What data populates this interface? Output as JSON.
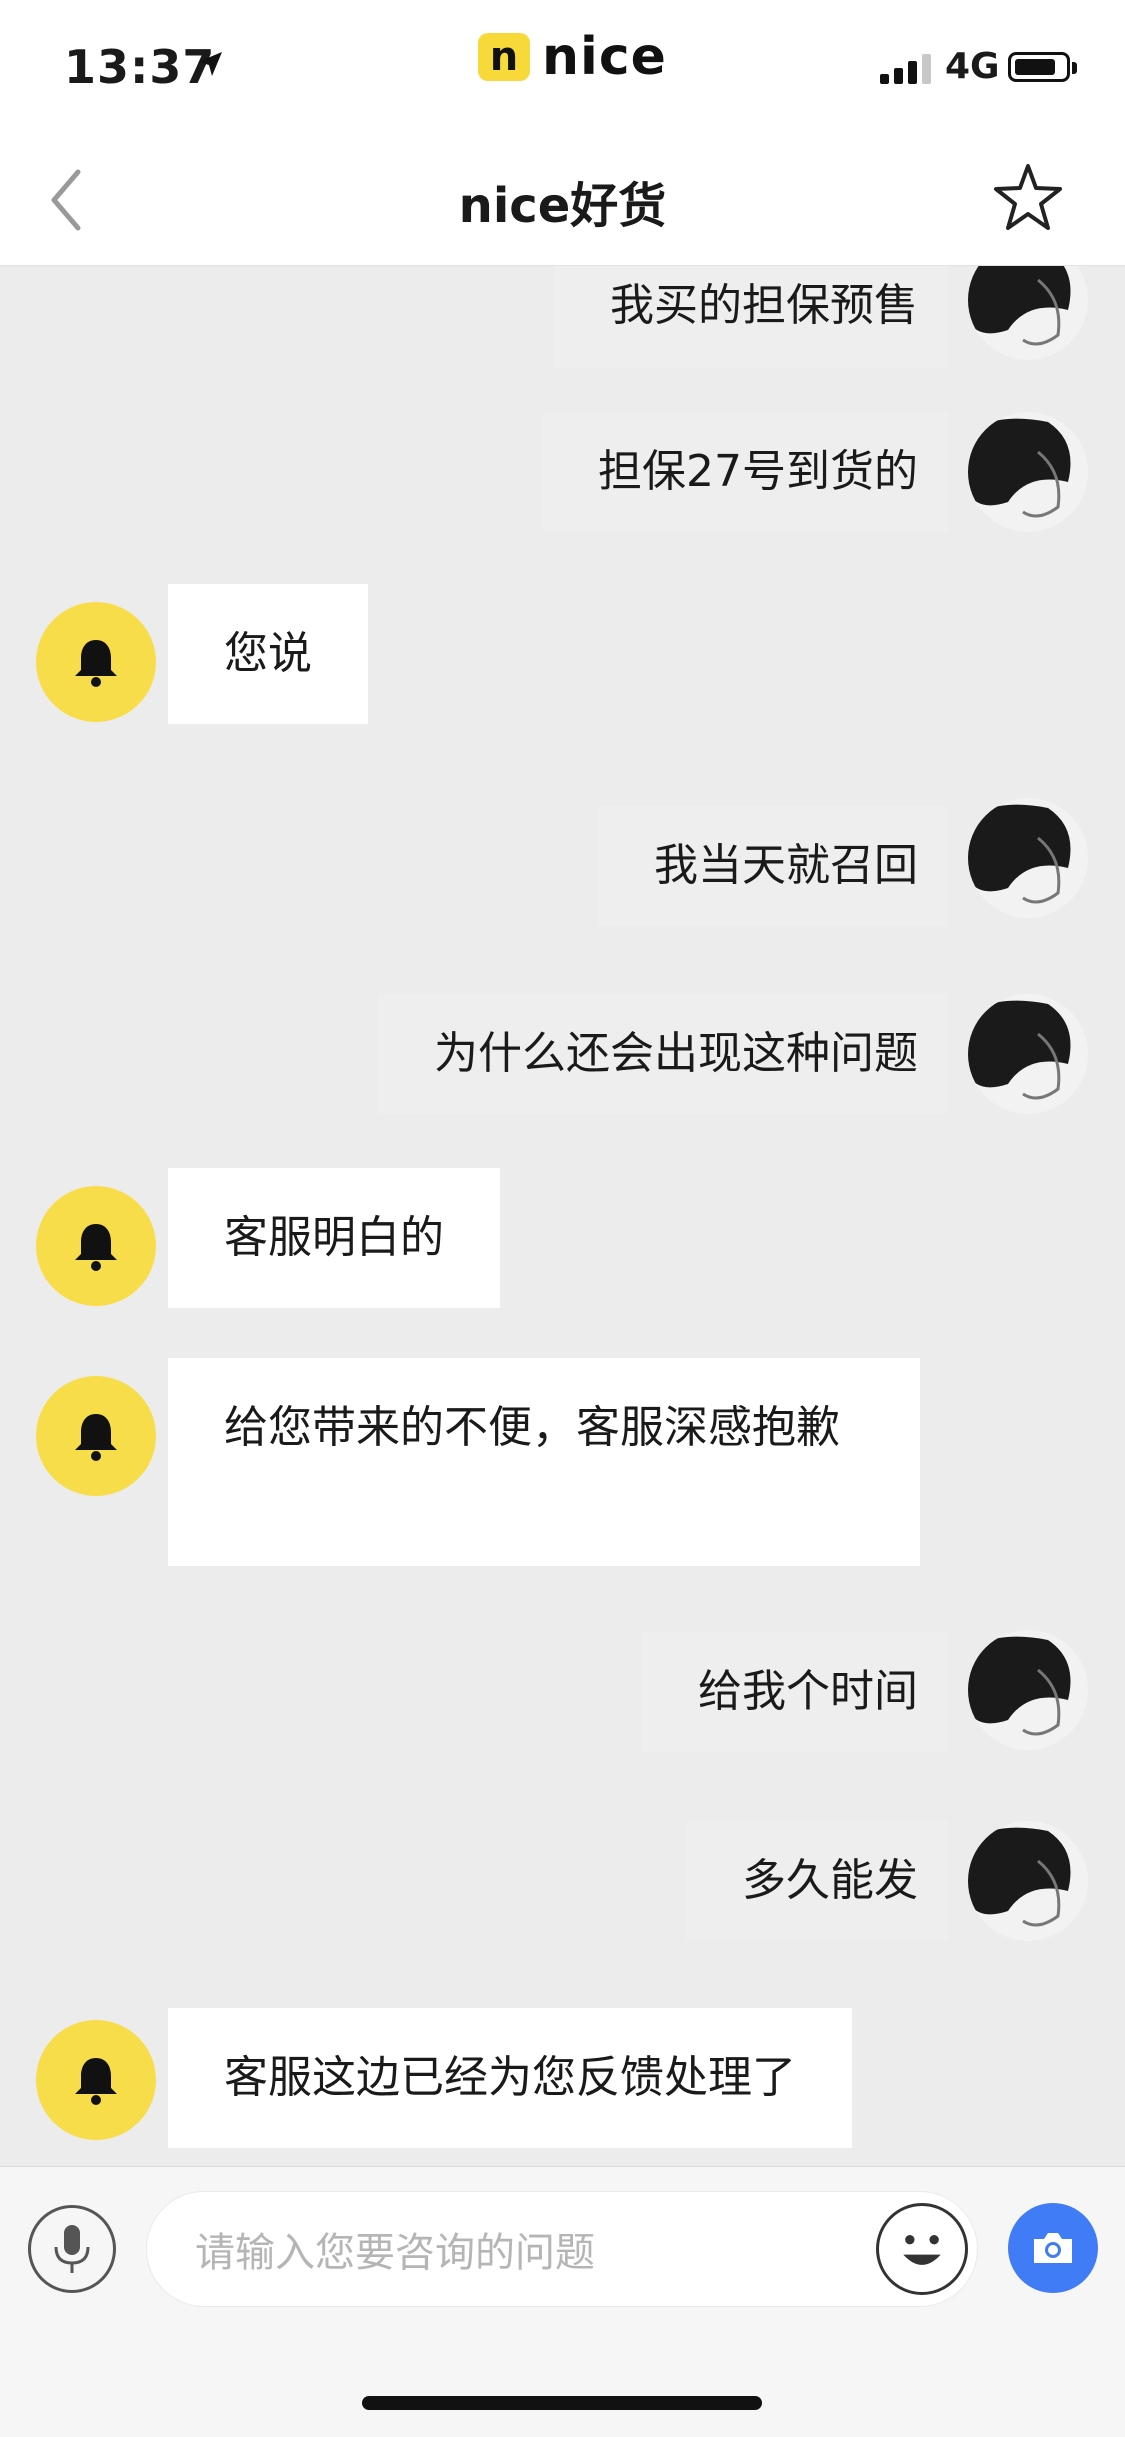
{
  "status_bar": {
    "time": "13:37",
    "network": "4G",
    "brand_badge": "n",
    "brand_word": "nice"
  },
  "nav": {
    "title": "nice好货",
    "back_icon": "chevron-left-icon",
    "favorite_icon": "star-icon"
  },
  "messages": [
    {
      "side": "right",
      "text": "我买的担保预售"
    },
    {
      "side": "right",
      "text": "担保27号到货的"
    },
    {
      "side": "left",
      "text": "您说"
    },
    {
      "side": "right",
      "text": "我当天就召回"
    },
    {
      "side": "right",
      "text": "为什么还会出现这种问题"
    },
    {
      "side": "left",
      "text": "客服明白的"
    },
    {
      "side": "left",
      "text": "给您带来的不便，客服深感抱歉"
    },
    {
      "side": "right",
      "text": "给我个时间"
    },
    {
      "side": "right",
      "text": "多久能发"
    },
    {
      "side": "left",
      "text": "客服这边已经为您反馈处理了"
    }
  ],
  "input": {
    "placeholder": "请输入您要咨询的问题"
  },
  "colors": {
    "accent_yellow": "#f8dd4a",
    "camera_blue": "#3f7cf6",
    "chat_background": "#ececec"
  }
}
